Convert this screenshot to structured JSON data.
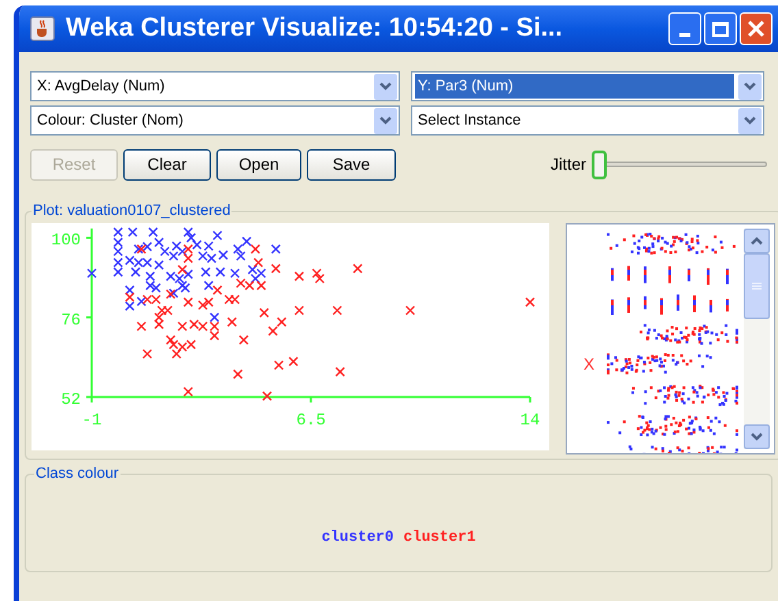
{
  "window": {
    "title": "Weka Clusterer Visualize: 10:54:20 - Si..."
  },
  "combos": [
    {
      "value": "X: AvgDelay (Num)",
      "highlighted": false
    },
    {
      "value": "Y: Par3 (Num)",
      "highlighted": true
    },
    {
      "value": "Colour: Cluster (Nom)",
      "highlighted": false
    },
    {
      "value": "Select Instance",
      "highlighted": false
    }
  ],
  "buttons": [
    {
      "label": "Reset",
      "disabled": true
    },
    {
      "label": "Clear",
      "disabled": false
    },
    {
      "label": "Open",
      "disabled": false
    },
    {
      "label": "Save",
      "disabled": false
    }
  ],
  "jitter": {
    "label": "Jitter",
    "level": 0
  },
  "plot": {
    "title": "Plot: valuation0107_clustered",
    "chart_data": {
      "type": "scatter",
      "xlim": [
        -1,
        14
      ],
      "ylim": [
        52,
        102.8
      ],
      "xticks": [
        -1,
        6.5,
        14
      ],
      "yticks": [
        52,
        76,
        100
      ],
      "series": [
        {
          "name": "cluster0",
          "color": "#3333ff",
          "x": [
            -1,
            -0.1,
            0.4,
            1.1,
            2.3,
            3.3,
            -0.1,
            -0.1,
            0.6,
            0.9,
            1.3,
            1.9,
            2.4,
            2.6,
            3.0,
            4.0,
            4.3,
            5.3,
            -0.1,
            0.3,
            0.6,
            0.9,
            1.3,
            1.5,
            1.8,
            2.1,
            2.8,
            3.1,
            3.5,
            4.1,
            -0.1,
            0.5,
            1.0,
            1.7,
            2.0,
            2.3,
            2.9,
            3.4,
            3.9,
            4.5,
            4.8,
            0.3,
            0.3,
            1.0,
            1.2,
            2.1,
            2.2,
            3.0,
            3.2,
            4.6,
            0.7,
            1.8
          ],
          "values": [
            89.3,
            101.7,
            101.7,
            101.7,
            101.7,
            100.7,
            98.6,
            95.9,
            96.6,
            97.3,
            98.6,
            97.5,
            100,
            97.9,
            97.5,
            96.6,
            98.9,
            96.6,
            92.5,
            93.2,
            92.5,
            92.5,
            91.8,
            95.9,
            94.5,
            95.9,
            94.5,
            93.8,
            94.8,
            94.5,
            89.7,
            89.7,
            88.4,
            88.4,
            87.7,
            89.0,
            89.7,
            89.7,
            89.3,
            90.4,
            89.3,
            84.2,
            79.4,
            85.6,
            84.9,
            85.6,
            84.9,
            85.6,
            76.0,
            87.7,
            80.8,
            83.3
          ]
        },
        {
          "name": "cluster1",
          "color": "#ff2020",
          "x": [
            0.7,
            2.3,
            4.6,
            4.7,
            5.3,
            6.1,
            6.7,
            6.8,
            8.1,
            2.3,
            2.1,
            4.1,
            4.4,
            4.8,
            3.3,
            0.3,
            0.9,
            1.2,
            1.7,
            2.3,
            2.8,
            3.0,
            3.7,
            3.9,
            1.4,
            1.6,
            4.9,
            6.1,
            7.4,
            9.9,
            14.0,
            3.8,
            5.5,
            5.2,
            0.7,
            1.3,
            2.1,
            2.5,
            2.8,
            3.2,
            3.2,
            4.2,
            1.7,
            1.8,
            2.1,
            2.4,
            1.9,
            0.9,
            4.0,
            5.4,
            5.9,
            7.5,
            2.3,
            5.0,
            1.3
          ],
          "values": [
            96.6,
            96.6,
            96.6,
            92.5,
            90.7,
            88.4,
            89.3,
            87.7,
            90.7,
            93.8,
            90.4,
            86.3,
            85.6,
            85.6,
            84.2,
            82.1,
            81.4,
            81.4,
            83.0,
            80.6,
            79.7,
            80.6,
            81.4,
            81.4,
            78.1,
            78.1,
            77.4,
            78.1,
            78.1,
            78.1,
            80.6,
            74.6,
            74.6,
            71.9,
            73.3,
            73.9,
            73.3,
            73.9,
            73.3,
            73.3,
            70.5,
            69.2,
            69.2,
            67.8,
            67.1,
            67.8,
            65.0,
            65.0,
            58.9,
            61.6,
            62.7,
            59.6,
            53.6,
            52.3,
            76.0
          ]
        }
      ]
    }
  },
  "attribute_panel": {
    "strips": [
      {
        "kind": "spread"
      },
      {
        "kind": "columns"
      },
      {
        "kind": "columns"
      },
      {
        "kind": "spread"
      },
      {
        "kind": "spread",
        "marker": "X"
      },
      {
        "kind": "spread"
      },
      {
        "kind": "spread"
      },
      {
        "kind": "spread"
      }
    ]
  },
  "class_colour": {
    "title": "Class colour"
  }
}
